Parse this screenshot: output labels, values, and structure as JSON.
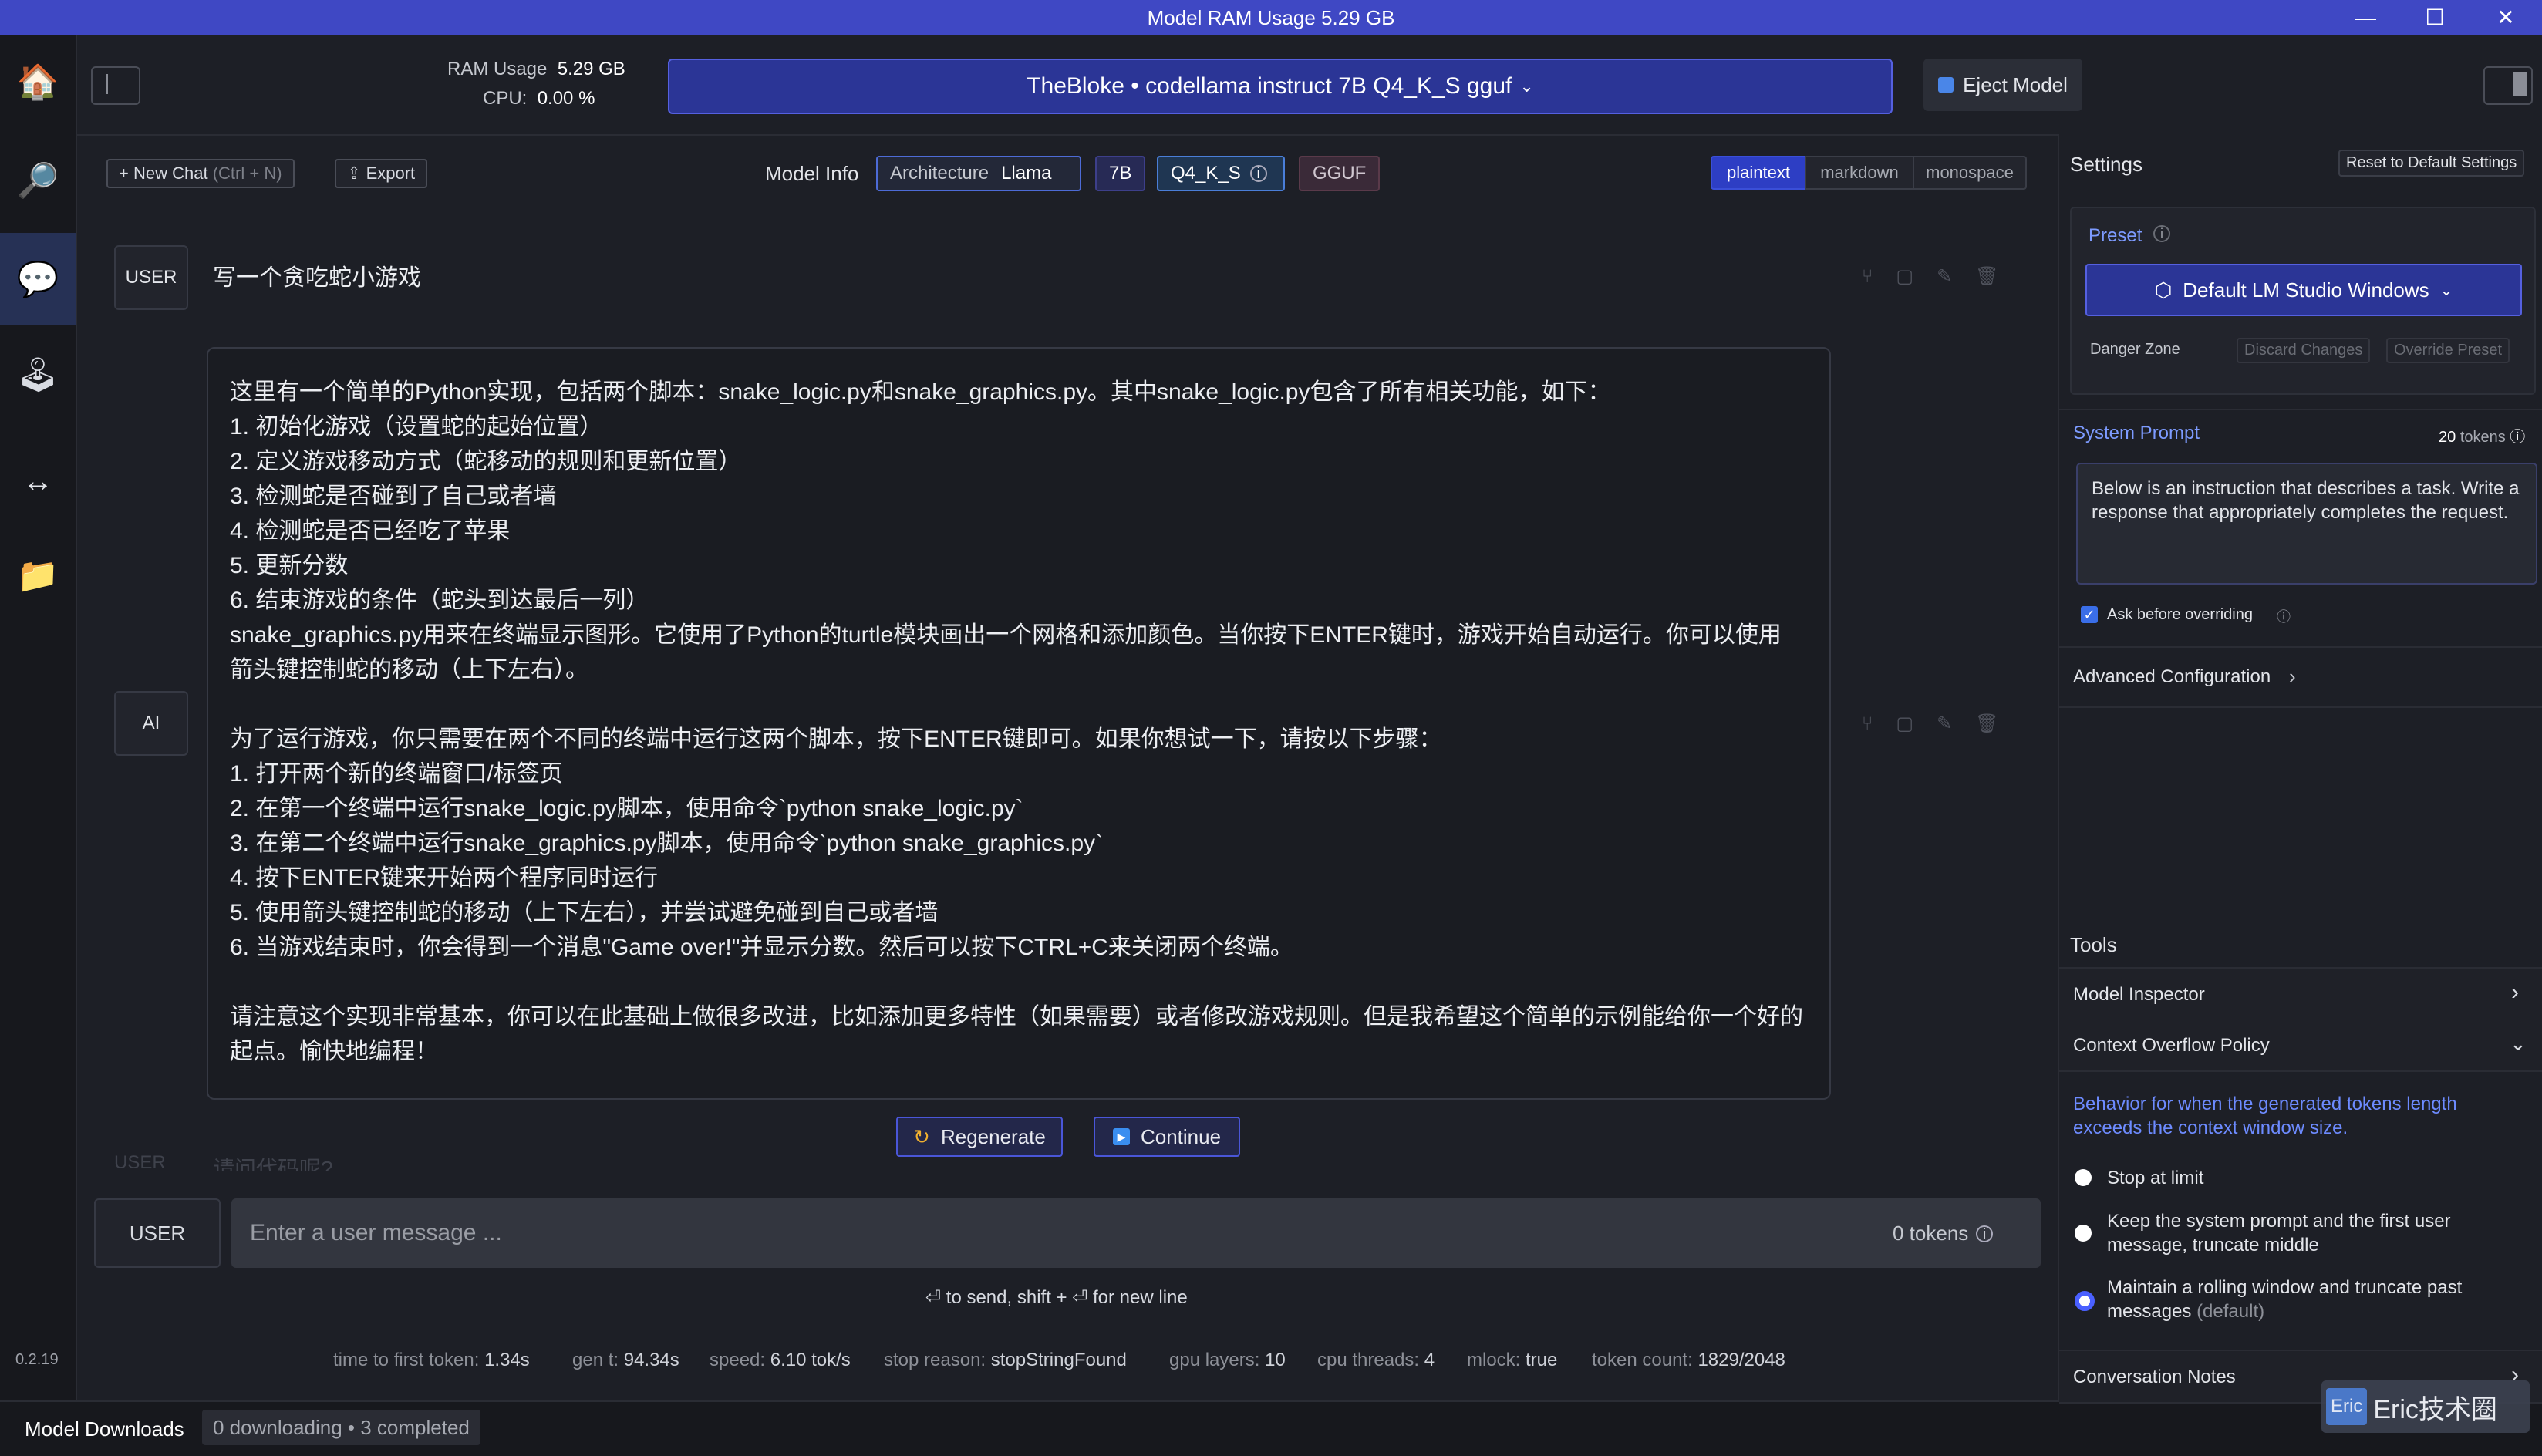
{
  "titlebar": {
    "title": "Model RAM Usage  5.29 GB",
    "minimize": "—",
    "maximize": "☐",
    "close": "✕"
  },
  "rail": {
    "version": "0.2.19"
  },
  "header": {
    "ram_label": "RAM Usage",
    "ram_value": "5.29 GB",
    "cpu_label": "CPU:",
    "cpu_value": "0.00 %",
    "model_name": "TheBloke • codellama instruct 7B Q4_K_S gguf",
    "eject_label": "Eject Model"
  },
  "toolbar": {
    "new_chat": "New Chat",
    "new_chat_shortcut": "(Ctrl + N)",
    "export": "Export",
    "model_info_label": "Model Info",
    "architecture_label": "Architecture",
    "architecture_value": "Llama",
    "size_badge": "7B",
    "quant_badge": "Q4_K_S",
    "format_badge": "GGUF",
    "render_modes": [
      "plaintext",
      "markdown",
      "monospace"
    ]
  },
  "chat": {
    "user_role": "USER",
    "ai_role": "AI",
    "user_message": "写一个贪吃蛇小游戏",
    "ai_message_lines": [
      "这里有一个简单的Python实现，包括两个脚本：snake_logic.py和snake_graphics.py。其中snake_logic.py包含了所有相关功能，如下：",
      "1. 初始化游戏（设置蛇的起始位置）",
      "2. 定义游戏移动方式（蛇移动的规则和更新位置）",
      "3. 检测蛇是否碰到了自己或者墙",
      "4. 检测蛇是否已经吃了苹果",
      "5. 更新分数",
      "6. 结束游戏的条件（蛇头到达最后一列）",
      "snake_graphics.py用来在终端显示图形。它使用了Python的turtle模块画出一个网格和添加颜色。当你按下ENTER键时，游戏开始自动运行。你可以使用",
      "箭头键控制蛇的移动（上下左右）。",
      "",
      "为了运行游戏，你只需要在两个不同的终端中运行这两个脚本，按下ENTER键即可。如果你想试一下，请按以下步骤：",
      "1. 打开两个新的终端窗口/标签页",
      "2. 在第一个终端中运行snake_logic.py脚本，使用命令`python snake_logic.py`",
      "3. 在第二个终端中运行snake_graphics.py脚本，使用命令`python snake_graphics.py`",
      "4. 按下ENTER键来开始两个程序同时运行",
      "5. 使用箭头键控制蛇的移动（上下左右），并尝试避免碰到自己或者墙",
      "6. 当游戏结束时，你会得到一个消息\"Game over!\"并显示分数。然后可以按下CTRL+C来关闭两个终端。",
      "",
      "请注意这个实现非常基本，你可以在此基础上做很多改进，比如添加更多特性（如果需要）或者修改游戏规则。但是我希望这个简单的示例能给你一个好的",
      "起点。愉快地编程！"
    ],
    "next_role_partial": "USER",
    "next_message_partial": "请问代码呢?",
    "regenerate": "Regenerate",
    "continue": "Continue"
  },
  "input": {
    "role": "USER",
    "placeholder": "Enter a user message ...",
    "tokens": "0 tokens",
    "hint": "⏎ to send, shift + ⏎ for new line"
  },
  "stats": [
    {
      "label": "time to first token:",
      "value": "1.34s"
    },
    {
      "label": "gen t:",
      "value": "94.34s"
    },
    {
      "label": "speed:",
      "value": "6.10 tok/s"
    },
    {
      "label": "stop reason:",
      "value": "stopStringFound"
    },
    {
      "label": "gpu layers:",
      "value": "10"
    },
    {
      "label": "cpu threads:",
      "value": "4"
    },
    {
      "label": "mlock:",
      "value": "true"
    },
    {
      "label": "token count:",
      "value": "1829/2048"
    }
  ],
  "bottom": {
    "downloads_label": "Model Downloads",
    "downloads_status": "0 downloading • 3 completed"
  },
  "settings": {
    "title": "Settings",
    "reset": "Reset to Default Settings",
    "preset_label": "Preset",
    "preset_value": "Default LM Studio Windows",
    "danger_zone": "Danger Zone",
    "discard": "Discard Changes",
    "override": "Override Preset",
    "system_prompt_label": "System Prompt",
    "system_prompt_tokens": "20",
    "system_prompt_tokens_unit": "tokens",
    "system_prompt": "Below is an instruction that describes a task. Write a response that appropriately completes the request.",
    "ask_before_overriding": "Ask before overriding",
    "advanced_config": "Advanced Configuration",
    "tools_title": "Tools",
    "model_inspector": "Model Inspector",
    "context_overflow": "Context Overflow Policy",
    "overflow_desc": "Behavior for when the generated tokens length exceeds the context window size.",
    "options": [
      {
        "label": "Stop at limit",
        "selected": false
      },
      {
        "label": "Keep the system prompt and the first user message, truncate middle",
        "selected": false
      },
      {
        "label": "Maintain a rolling window and truncate past messages",
        "suffix": "(default)",
        "selected": true
      }
    ],
    "conversation_notes": "Conversation Notes"
  },
  "watermark": {
    "logo": "Eric",
    "text": "Eric技术圈"
  },
  "colors": {
    "accent": "#3f48c4",
    "panel": "#1d1f26",
    "rail": "#17181d",
    "link": "#6d8bff"
  }
}
